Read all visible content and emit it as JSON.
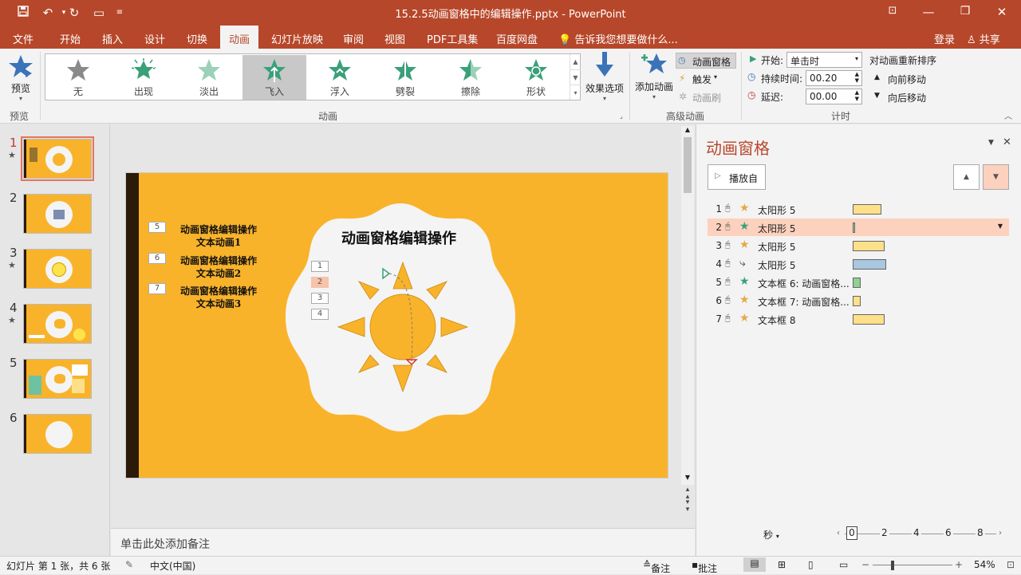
{
  "titlebar": {
    "title": "15.2.5动画窗格中的编辑操作.pptx - PowerPoint",
    "save_icon": "save-icon",
    "bg_color": "#b7472a"
  },
  "tabs": [
    "文件",
    "开始",
    "插入",
    "设计",
    "切换",
    "动画",
    "幻灯片放映",
    "审阅",
    "视图",
    "PDF工具集",
    "百度网盘"
  ],
  "active_tab": "动画",
  "tellme": "告诉我您想要做什么...",
  "login": "登录",
  "share": "共享",
  "ribbon": {
    "preview_label": "预览",
    "preview_group": "预览",
    "animations": [
      "无",
      "出现",
      "淡出",
      "飞入",
      "浮入",
      "劈裂",
      "擦除",
      "形状"
    ],
    "selected_animation": "飞入",
    "effect_options": "效果选项",
    "animation_group": "动画",
    "add_animation": "添加动画",
    "anim_pane_btn": "动画窗格",
    "trigger": "触发",
    "anim_painter": "动画刷",
    "advanced_group": "高级动画",
    "start_label": "开始:",
    "start_value": "单击时",
    "duration_label": "持续时间:",
    "duration_value": "00.20",
    "delay_label": "延迟:",
    "delay_value": "00.00",
    "reorder_title": "对动画重新排序",
    "move_earlier": "向前移动",
    "move_later": "向后移动",
    "timing_group": "计时"
  },
  "slides": {
    "numbers": [
      "1",
      "2",
      "3",
      "4",
      "5",
      "6"
    ],
    "stars": [
      "1",
      "3",
      "4"
    ]
  },
  "slide": {
    "title": "动画窗格编辑操作",
    "text1a": "动画窗格编辑操作",
    "text1b": "文本动画1",
    "text2a": "动画窗格编辑操作",
    "text2b": "文本动画2",
    "text3a": "动画窗格编辑操作",
    "text3b": "文本动画3",
    "tag5": "5",
    "tag6": "6",
    "tag7": "7",
    "seq": [
      "1",
      "2",
      "3",
      "4"
    ],
    "bg_color": "#f9b32a"
  },
  "notes_placeholder": "单击此处添加备注",
  "animpane": {
    "title": "动画窗格",
    "play_from": "播放自",
    "items": [
      {
        "n": "1",
        "label": "太阳形 5",
        "color": "#ffe08a"
      },
      {
        "n": "2",
        "label": "太阳形 5",
        "color": "#8fd18f"
      },
      {
        "n": "3",
        "label": "太阳形 5",
        "color": "#ffe08a"
      },
      {
        "n": "4",
        "label": "太阳形 5",
        "color": "#a9c7e0"
      },
      {
        "n": "5",
        "label": "文本框 6: 动画窗格...",
        "color": "#8fd18f"
      },
      {
        "n": "6",
        "label": "文本框 7: 动画窗格...",
        "color": "#ffe08a"
      },
      {
        "n": "7",
        "label": "文本框 8",
        "color": "#ffe08a"
      }
    ],
    "seconds_label": "秒",
    "timeline": [
      "0",
      "2",
      "4",
      "6",
      "8"
    ]
  },
  "status": {
    "slide_info": "幻灯片 第 1 张，共 6 张",
    "language": "中文(中国)",
    "notes": "备注",
    "comments": "批注",
    "zoom": "54%"
  }
}
